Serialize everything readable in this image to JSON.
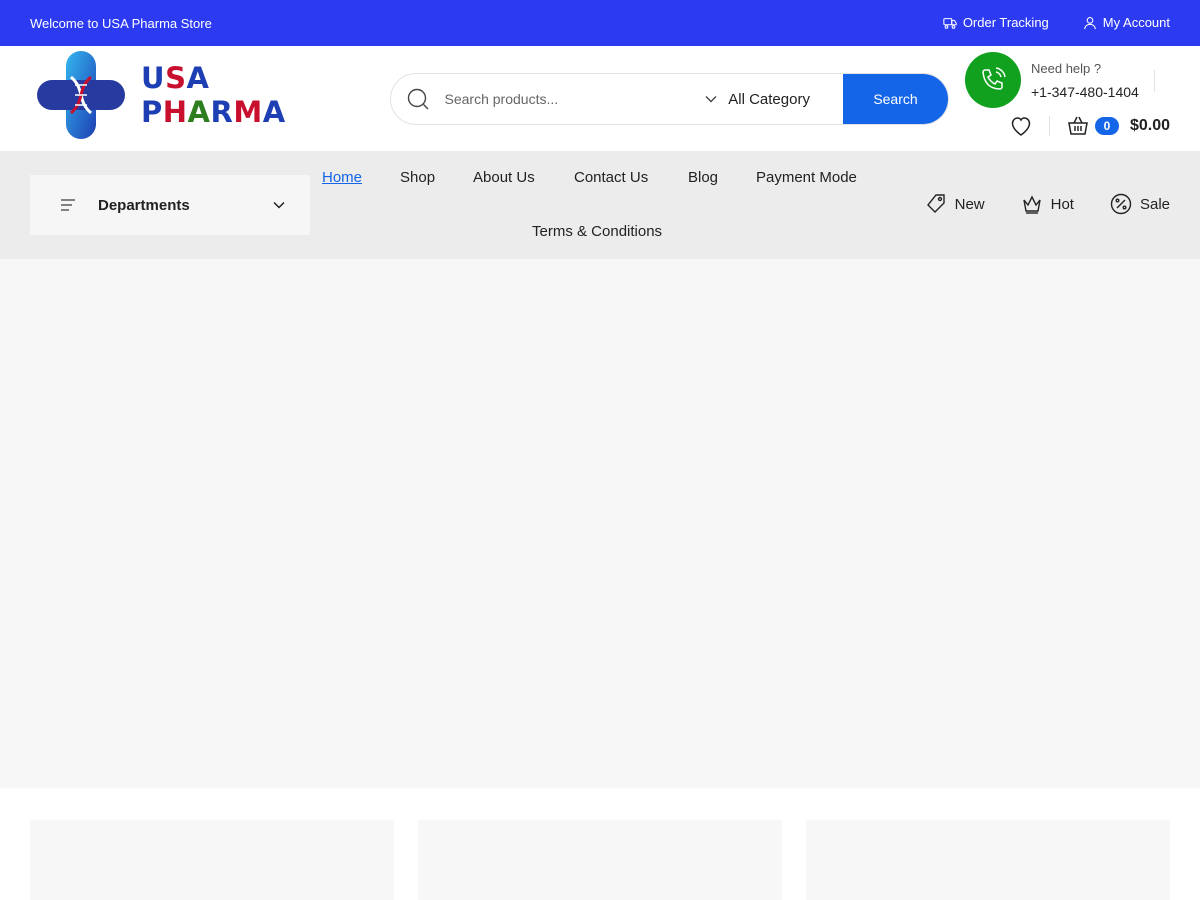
{
  "topbar": {
    "welcome": "Welcome to USA Pharma Store",
    "order_tracking": "Order Tracking",
    "my_account": "My Account",
    "bg_color": "#2c3bf2"
  },
  "header": {
    "logo_text": "USA PHARMA",
    "search": {
      "placeholder": "Search products...",
      "category": "All Category",
      "button": "Search"
    },
    "help": {
      "label": "Need help ?",
      "phone": "+1-347-480-1404"
    },
    "cart": {
      "count": "0",
      "total": "$0.00"
    }
  },
  "nav": {
    "departments": "Departments",
    "items": [
      {
        "label": "Home",
        "active": true
      },
      {
        "label": "Shop"
      },
      {
        "label": "About Us"
      },
      {
        "label": "Contact Us"
      },
      {
        "label": "Blog"
      },
      {
        "label": "Payment Mode"
      },
      {
        "label": "Terms & Conditions"
      }
    ],
    "tags": {
      "new": "New",
      "hot": "Hot",
      "sale": "Sale"
    }
  },
  "colors": {
    "accent": "#1565e8",
    "phone_green": "#12a11e"
  }
}
